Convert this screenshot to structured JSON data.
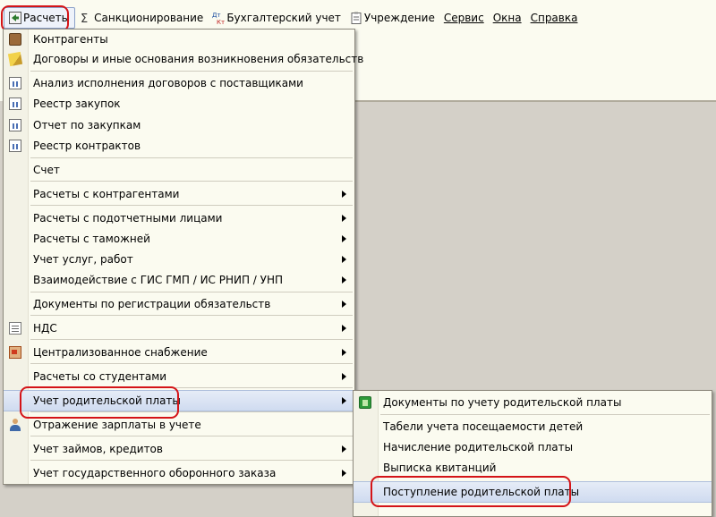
{
  "menubar": {
    "items": [
      {
        "label": "Расчеты",
        "icon": "arrow-icon"
      },
      {
        "label": "Санкционирование",
        "icon": "sigma-icon"
      },
      {
        "label": "Бухгалтерский учет",
        "icon": "debit-credit-icon"
      },
      {
        "label": "Учреждение",
        "icon": "clipboard-icon"
      },
      {
        "label": "Сервис"
      },
      {
        "label": "Окна"
      },
      {
        "label": "Справка"
      }
    ]
  },
  "main_menu": {
    "items": [
      {
        "label": "Контрагенты",
        "icon": "briefcase-icon"
      },
      {
        "label": "Договоры и иные основания возникновения обязательств",
        "icon": "pencil-icon"
      },
      {
        "label": "Анализ исполнения договоров с поставщиками",
        "icon": "report-icon"
      },
      {
        "label": "Реестр закупок",
        "icon": "report-icon"
      },
      {
        "label": "Отчет по закупкам",
        "icon": "report-icon"
      },
      {
        "label": "Реестр контрактов",
        "icon": "report-icon"
      },
      {
        "label": "Счет"
      },
      {
        "label": "Расчеты с контрагентами",
        "submenu": true
      },
      {
        "label": "Расчеты с подотчетными лицами",
        "submenu": true
      },
      {
        "label": "Расчеты с таможней",
        "submenu": true
      },
      {
        "label": "Учет услуг, работ",
        "submenu": true
      },
      {
        "label": "Взаимодействие с ГИС ГМП / ИС РНИП / УНП",
        "submenu": true
      },
      {
        "label": "Документы по регистрации обязательств",
        "submenu": true
      },
      {
        "label": "НДС",
        "icon": "document-icon",
        "submenu": true
      },
      {
        "label": "Централизованное снабжение",
        "icon": "supply-icon",
        "submenu": true
      },
      {
        "label": "Расчеты со студентами",
        "submenu": true
      },
      {
        "label": "Учет родительской платы",
        "submenu": true
      },
      {
        "label": "Отражение зарплаты в учете",
        "icon": "people-icon"
      },
      {
        "label": "Учет займов, кредитов",
        "submenu": true
      },
      {
        "label": "Учет государственного оборонного заказа",
        "submenu": true
      }
    ]
  },
  "sub_menu": {
    "items": [
      {
        "label": "Документы по учету родительской платы",
        "icon": "green-register-icon"
      },
      {
        "label": "Табели учета посещаемости детей"
      },
      {
        "label": "Начисление родительской платы"
      },
      {
        "label": "Выписка квитанций"
      },
      {
        "label": "Поступление родительской платы"
      }
    ]
  }
}
